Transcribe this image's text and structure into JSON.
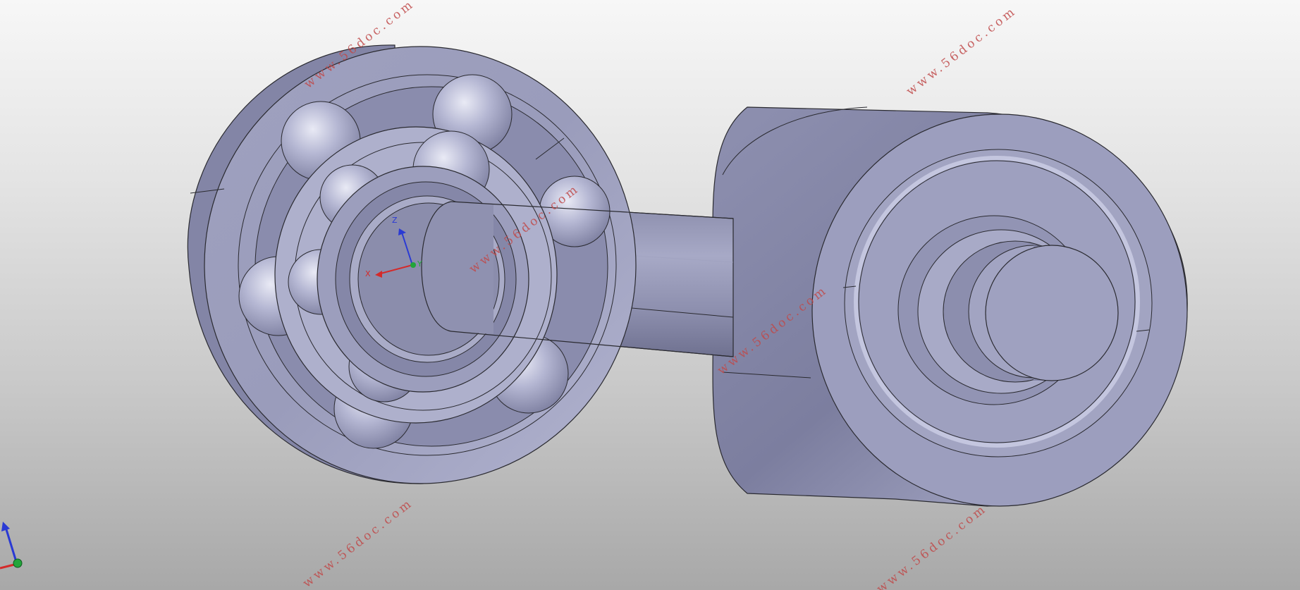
{
  "viewport": {
    "label": "3D model viewport"
  },
  "watermarks": [
    "www.56doc.com",
    "www.56doc.com",
    "www.56doc.com",
    "www.56doc.com",
    "www.56doc.com",
    "www.56doc.com"
  ],
  "triad": {
    "x_label": "X",
    "y_label": "Y",
    "z_label": "Z"
  },
  "colors": {
    "part_face": "#a3a5c2",
    "part_shadow": "#7a7c9e",
    "part_edge": "#2a2a30",
    "axis_x": "#d42a2a",
    "axis_y": "#22a53a",
    "axis_z": "#2a3ad4",
    "watermark": "#c04a4a"
  }
}
